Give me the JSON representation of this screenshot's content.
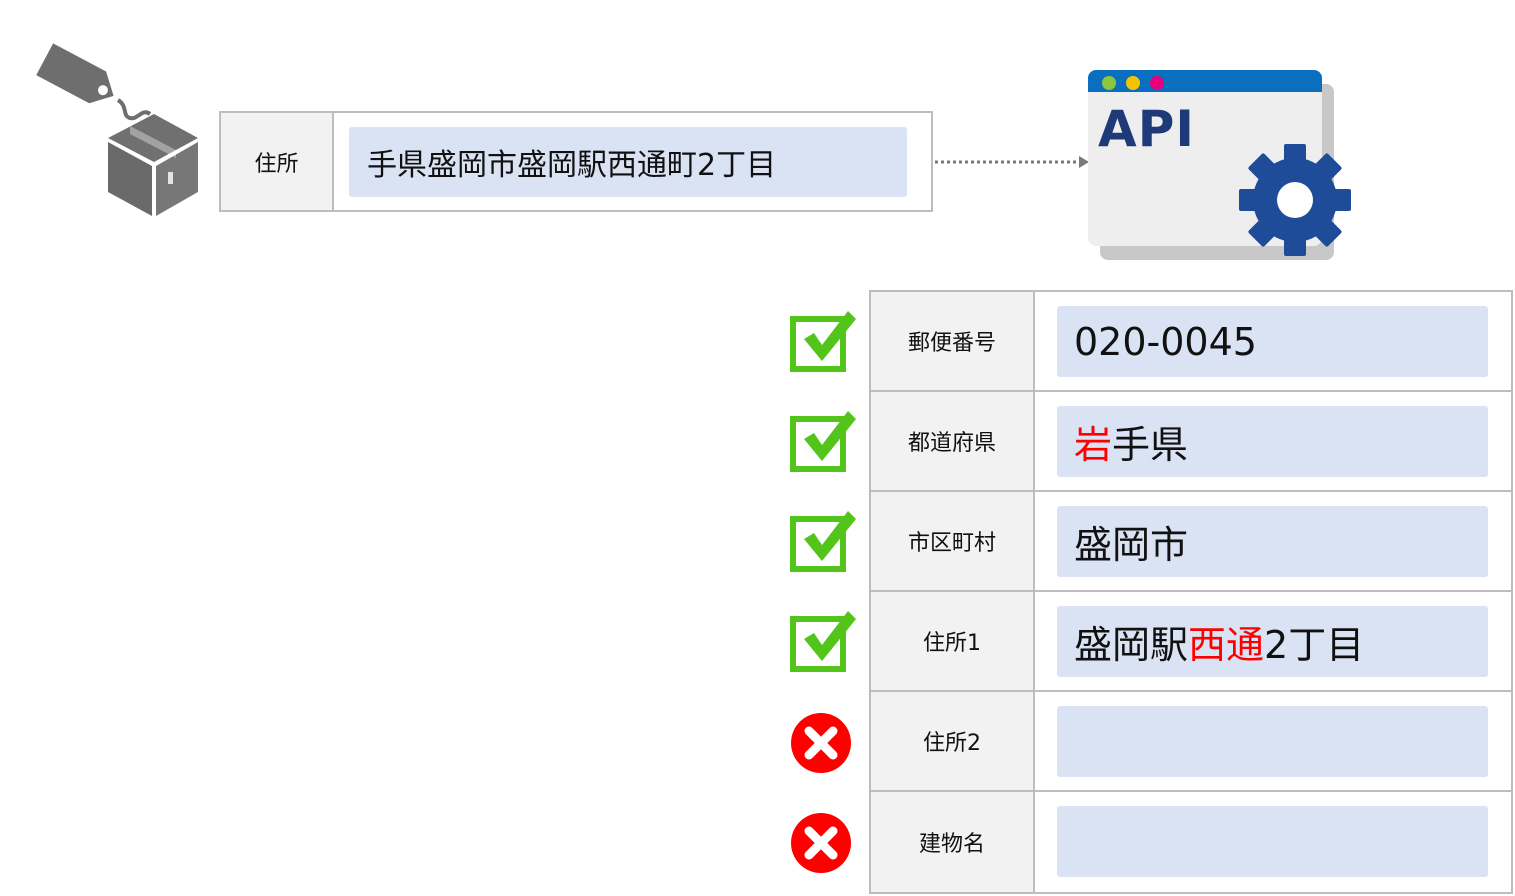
{
  "input": {
    "label": "住所",
    "value": "手県盛岡市盛岡駅西通町2丁目"
  },
  "api": {
    "title": "API"
  },
  "colors": {
    "check": "#52c41a",
    "error": "#ff0000",
    "highlight": "#ff0000",
    "field_bg": "#dae3f3",
    "api_blue": "#1f3a78"
  },
  "results": [
    {
      "label": "郵便番号",
      "parts": [
        {
          "text": "020-0045",
          "highlight": false
        }
      ],
      "status": "check-icon"
    },
    {
      "label": "都道府県",
      "parts": [
        {
          "text": "岩",
          "highlight": true
        },
        {
          "text": "手県",
          "highlight": false
        }
      ],
      "status": "check-icon"
    },
    {
      "label": "市区町村",
      "parts": [
        {
          "text": "盛岡市",
          "highlight": false
        }
      ],
      "status": "check-icon"
    },
    {
      "label": "住所1",
      "parts": [
        {
          "text": "盛岡駅",
          "highlight": false
        },
        {
          "text": "西通",
          "highlight": true
        },
        {
          "text": "2丁目",
          "highlight": false
        }
      ],
      "status": "check-icon"
    },
    {
      "label": "住所2",
      "parts": [],
      "status": "error-icon"
    },
    {
      "label": "建物名",
      "parts": [],
      "status": "error-icon"
    }
  ]
}
